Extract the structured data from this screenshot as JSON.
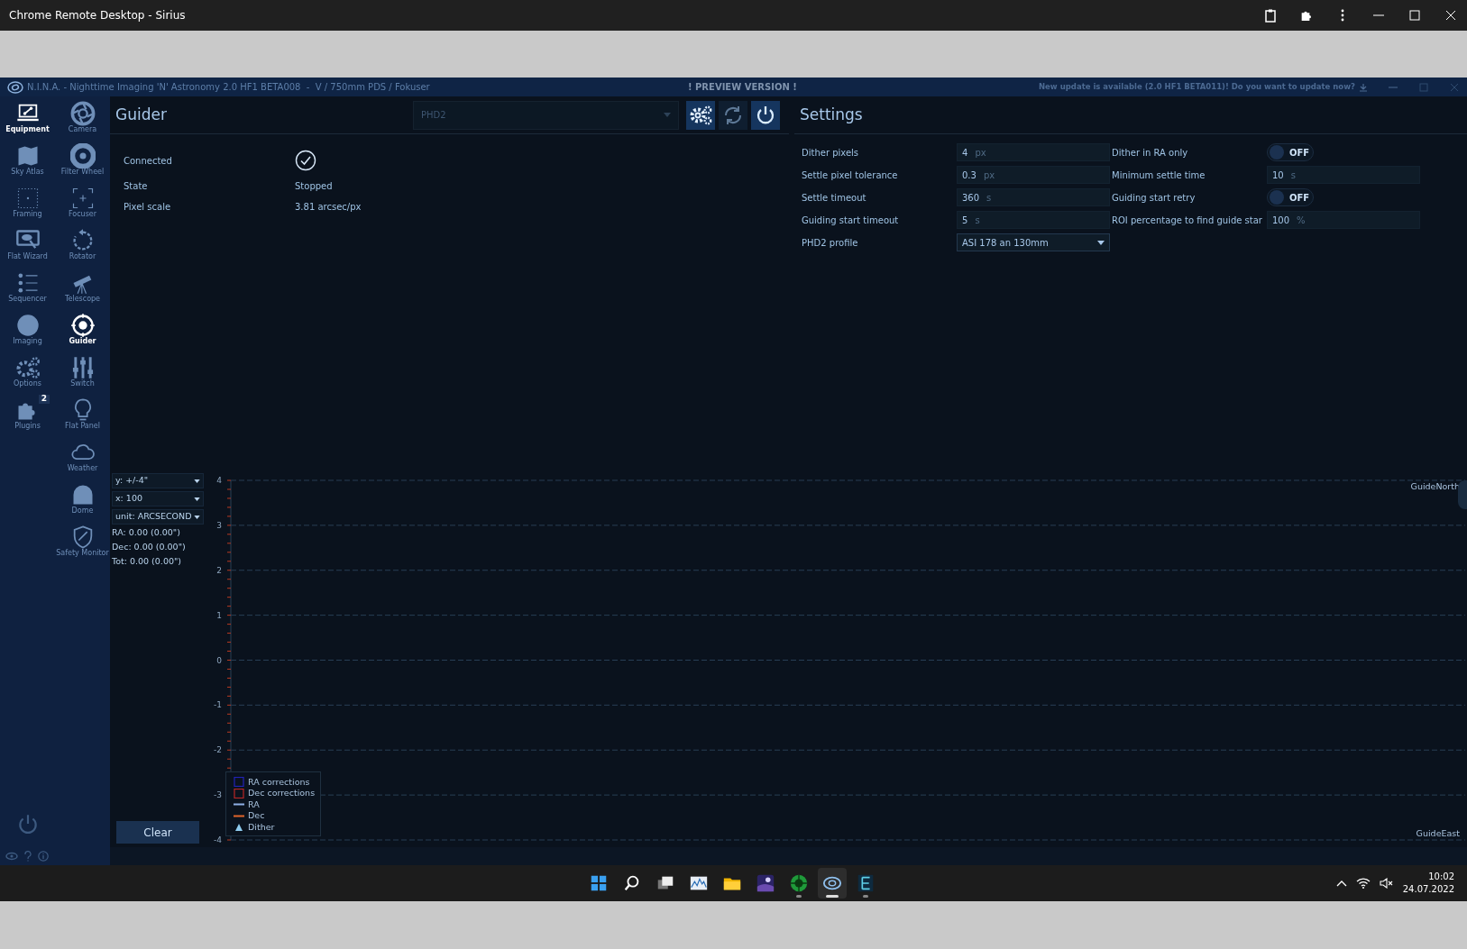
{
  "remote_window": {
    "title": "Chrome Remote Desktop - Sirius"
  },
  "app": {
    "title": "N.I.N.A. - Nighttime Imaging 'N' Astronomy 2.0 HF1 BETA008  -  V / 750mm PDS / Fokuser",
    "banner": "! PREVIEW VERSION !",
    "update_notice": "New update is available (2.0 HF1 BETA011)! Do you want to update now?"
  },
  "sidebar": {
    "main_items": [
      {
        "label": "Equipment",
        "selected": true
      },
      {
        "label": "Sky Atlas",
        "selected": false
      },
      {
        "label": "Framing",
        "selected": false
      },
      {
        "label": "Flat Wizard",
        "selected": false
      },
      {
        "label": "Sequencer",
        "selected": false
      },
      {
        "label": "Imaging",
        "selected": false
      },
      {
        "label": "Options",
        "selected": false
      },
      {
        "label": "Plugins",
        "selected": false,
        "badge": "2"
      }
    ],
    "equipment_items": [
      {
        "label": "Camera",
        "selected": false
      },
      {
        "label": "Filter Wheel",
        "selected": false
      },
      {
        "label": "Focuser",
        "selected": false
      },
      {
        "label": "Rotator",
        "selected": false
      },
      {
        "label": "Telescope",
        "selected": false
      },
      {
        "label": "Guider",
        "selected": true
      },
      {
        "label": "Switch",
        "selected": false
      },
      {
        "label": "Flat Panel",
        "selected": false
      },
      {
        "label": "Weather",
        "selected": false
      },
      {
        "label": "Dome",
        "selected": false
      },
      {
        "label": "Safety Monitor",
        "selected": false
      }
    ]
  },
  "guider": {
    "title": "Guider",
    "device": "PHD2",
    "connected": true,
    "info": [
      {
        "label": "Connected",
        "kind": "check",
        "checked": true
      },
      {
        "label": "State",
        "kind": "text",
        "value": "Stopped"
      },
      {
        "label": "Pixel scale",
        "kind": "text",
        "value": "3.81 arcsec/px"
      }
    ]
  },
  "settings": {
    "title": "Settings",
    "fields": [
      {
        "label": "Dither pixels",
        "kind": "number",
        "value": "4",
        "unit": "px"
      },
      {
        "label": "Dither in RA only",
        "kind": "toggle",
        "on": false,
        "state_label": "OFF"
      },
      {
        "label": "Settle pixel tolerance",
        "kind": "number",
        "value": "0.3",
        "unit": "px"
      },
      {
        "label": "Minimum settle time",
        "kind": "number",
        "value": "10",
        "unit": "s"
      },
      {
        "label": "Settle timeout",
        "kind": "number",
        "value": "360",
        "unit": "s"
      },
      {
        "label": "Guiding start retry",
        "kind": "toggle",
        "on": false,
        "state_label": "OFF"
      },
      {
        "label": "Guiding start timeout",
        "kind": "number",
        "value": "5",
        "unit": "s"
      },
      {
        "label": "ROI percentage to find guide star",
        "kind": "number",
        "value": "100",
        "unit": "%"
      },
      {
        "label": "PHD2 profile",
        "kind": "dropdown",
        "value": "ASI 178 an 130mm"
      }
    ]
  },
  "graph": {
    "y_range": "y: +/-4\"",
    "x_range": "x: 100",
    "unit": "unit: ARCSECOND",
    "stats": [
      "RA: 0.00 (0.00\")",
      "Dec: 0.00 (0.00\")",
      "Tot: 0.00 (0.00\")"
    ],
    "clear_button": "Clear",
    "legend_markers": [
      {
        "kind": "square"
      },
      {
        "kind": "square"
      },
      {
        "kind": "line"
      },
      {
        "kind": "line"
      },
      {
        "kind": "triangle"
      }
    ],
    "chart_data": {
      "type": "line",
      "grid": true,
      "ylim": [
        -4,
        4
      ],
      "yticks": [
        -4,
        -3,
        -2,
        -1,
        0,
        1,
        2,
        3,
        4
      ],
      "series": [
        {
          "name": "RA corrections",
          "color": "#2222b8"
        },
        {
          "name": "Dec corrections",
          "color": "#b82626"
        },
        {
          "name": "RA",
          "color": "#8fb0e6"
        },
        {
          "name": "Dec",
          "color": "#e0652b"
        },
        {
          "name": "Dither",
          "color": "#8ecbee"
        }
      ],
      "annotations": [
        {
          "text": "GuideNorth"
        },
        {
          "text": "GuideEast"
        }
      ]
    }
  },
  "taskbar": {
    "apps": [
      {
        "running": false,
        "selected": false
      },
      {
        "running": false,
        "selected": false
      },
      {
        "running": false,
        "selected": false
      },
      {
        "running": false,
        "selected": false
      },
      {
        "running": false,
        "selected": false
      },
      {
        "running": false,
        "selected": false
      },
      {
        "running": true,
        "selected": false
      },
      {
        "running": true,
        "selected": true
      },
      {
        "running": true,
        "selected": false
      }
    ],
    "clock": {
      "time": "10:02",
      "date": "24.07.2022"
    }
  }
}
